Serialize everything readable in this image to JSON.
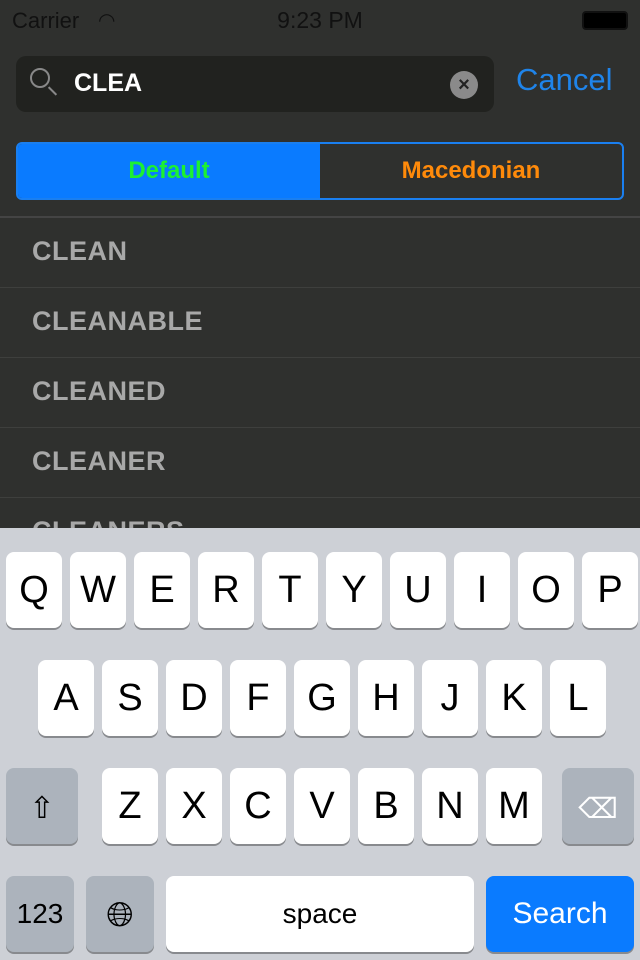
{
  "status": {
    "carrier": "Carrier",
    "time": "9:23 PM"
  },
  "search": {
    "query": "CLEA",
    "cancel": "Cancel"
  },
  "segments": {
    "default": "Default",
    "macedonian": "Macedonian"
  },
  "colors": {
    "accent": "#0a7bff",
    "default_text": "#1cf032",
    "macedonian_text": "#ff8a0a"
  },
  "results": [
    "CLEAN",
    "CLEANABLE",
    "CLEANED",
    "CLEANER",
    "CLEANERS"
  ],
  "keyboard": {
    "row1": [
      "Q",
      "W",
      "E",
      "R",
      "T",
      "Y",
      "U",
      "I",
      "O",
      "P"
    ],
    "row2": [
      "A",
      "S",
      "D",
      "F",
      "G",
      "H",
      "J",
      "K",
      "L"
    ],
    "row3": [
      "Z",
      "X",
      "C",
      "V",
      "B",
      "N",
      "M"
    ],
    "numbers": "123",
    "space": "space",
    "search": "Search"
  }
}
